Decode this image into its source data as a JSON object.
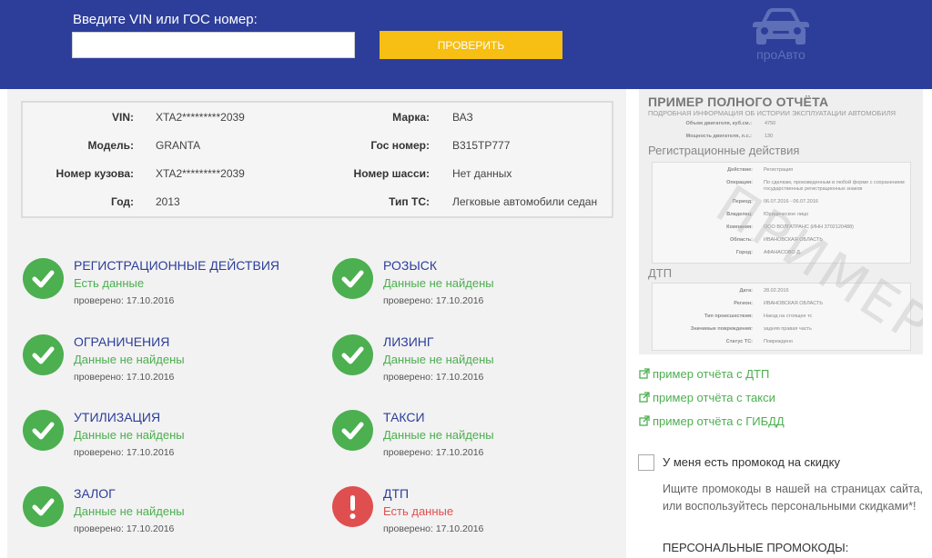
{
  "header": {
    "label": "Введите VIN или ГОС номер:",
    "input_value": "",
    "button_label": "ПРОВЕРИТЬ",
    "logo_text": "проАвто"
  },
  "vehicle": {
    "vin_label": "VIN:",
    "vin_value": "XTA2*********2039",
    "model_label": "Модель:",
    "model_value": "GRANTA",
    "body_label": "Номер кузова:",
    "body_value": "XTA2*********2039",
    "year_label": "Год:",
    "year_value": "2013",
    "make_label": "Марка:",
    "make_value": "ВАЗ",
    "plate_label": "Гос номер:",
    "plate_value": "В315ТР777",
    "chassis_label": "Номер шасси:",
    "chassis_value": "Нет данных",
    "type_label": "Тип ТС:",
    "type_value": "Легковые автомобили седан"
  },
  "checks": [
    {
      "title": "РЕГИСТРАЦИОННЫЕ ДЕЙСТВИЯ",
      "result": "Есть данные",
      "date": "проверено: 17.10.2016",
      "status": "ok"
    },
    {
      "title": "РОЗЫСК",
      "result": "Данные не найдены",
      "date": "проверено: 17.10.2016",
      "status": "ok"
    },
    {
      "title": "ОГРАНИЧЕНИЯ",
      "result": "Данные не найдены",
      "date": "проверено: 17.10.2016",
      "status": "ok"
    },
    {
      "title": "ЛИЗИНГ",
      "result": "Данные не найдены",
      "date": "проверено: 17.10.2016",
      "status": "ok"
    },
    {
      "title": "УТИЛИЗАЦИЯ",
      "result": "Данные не найдены",
      "date": "проверено: 17.10.2016",
      "status": "ok"
    },
    {
      "title": "ТАКСИ",
      "result": "Данные не найдены",
      "date": "проверено: 17.10.2016",
      "status": "ok"
    },
    {
      "title": "ЗАЛОГ",
      "result": "Данные не найдены",
      "date": "проверено: 17.10.2016",
      "status": "ok"
    },
    {
      "title": "ДТП",
      "result": "Есть данные",
      "date": "проверено: 17.10.2016",
      "status": "error"
    }
  ],
  "sample": {
    "title": "ПРИМЕР ПОЛНОГО ОТЧЁТА",
    "subtitle": "ПОДРОБНАЯ ИНФОРМАЦИЯ ОБ ИСТОРИИ ЭКСПЛУАТАЦИИ АВТОМОБИЛЯ",
    "engine_volume_label": "Объем двигателя, куб.см.:",
    "engine_volume_value": "4750",
    "engine_power_label": "Мощность двигателя, л.с.:",
    "engine_power_value": "130",
    "reg_heading": "Регистрационные действия",
    "reg_action_label": "Действие:",
    "reg_action_value": "Регистрация",
    "reg_operation_label": "Операция:",
    "reg_operation_value": "По сделкам, произведенным в любой форме с сохранением",
    "reg_operation_value2": "государственных регистрационных знаков",
    "reg_period_label": "Период:",
    "reg_period_value": "06.07.2016 - 06.07.2016",
    "reg_owner_label": "Владелец:",
    "reg_owner_value": "Юридическое лицо",
    "reg_company_label": "Компания:",
    "reg_company_value": "ООО ВОЛГАТРАНС (ИНН 3702120488)",
    "reg_region_label": "Область:",
    "reg_region_value": "ИВАНОВСКАЯ ОБЛАСТЬ",
    "reg_city_label": "Город:",
    "reg_city_value": "АФАНАСОВО Д.",
    "dtp_heading": "ДТП",
    "dtp_date_label": "Дата:",
    "dtp_date_value": "28.02.2016",
    "dtp_region_label": "Регион:",
    "dtp_region_value": "ИВАНОВСКАЯ ОБЛАСТЬ",
    "dtp_type_label": "Тип происшествия:",
    "dtp_type_value": "Наезд на стоящее тс",
    "dtp_damage_label": "Значимые повреждения:",
    "dtp_damage_value": "задняя правая часть",
    "dtp_status_label": "Статус ТС:",
    "dtp_status_value": "Повреждено",
    "watermark": "ПРИМЕР"
  },
  "links": {
    "dtp": "пример отчёта с ДТП",
    "taxi": "пример отчёта с такси",
    "gibdd": "пример отчёта с ГИБДД"
  },
  "promo": {
    "checkbox_label": "У меня есть промокод на скидку",
    "description": "Ищите промокоды в нашей на страницах сайта, или воспользуйтесь персональными скидками*!",
    "heading": "ПЕРСОНАЛЬНЫЕ ПРОМОКОДЫ:"
  },
  "colors": {
    "header_bg": "#2d3e9a",
    "button_bg": "#f7be13",
    "success": "#4caf50",
    "error": "#e04f4f",
    "title_blue": "#2d3e9a"
  }
}
